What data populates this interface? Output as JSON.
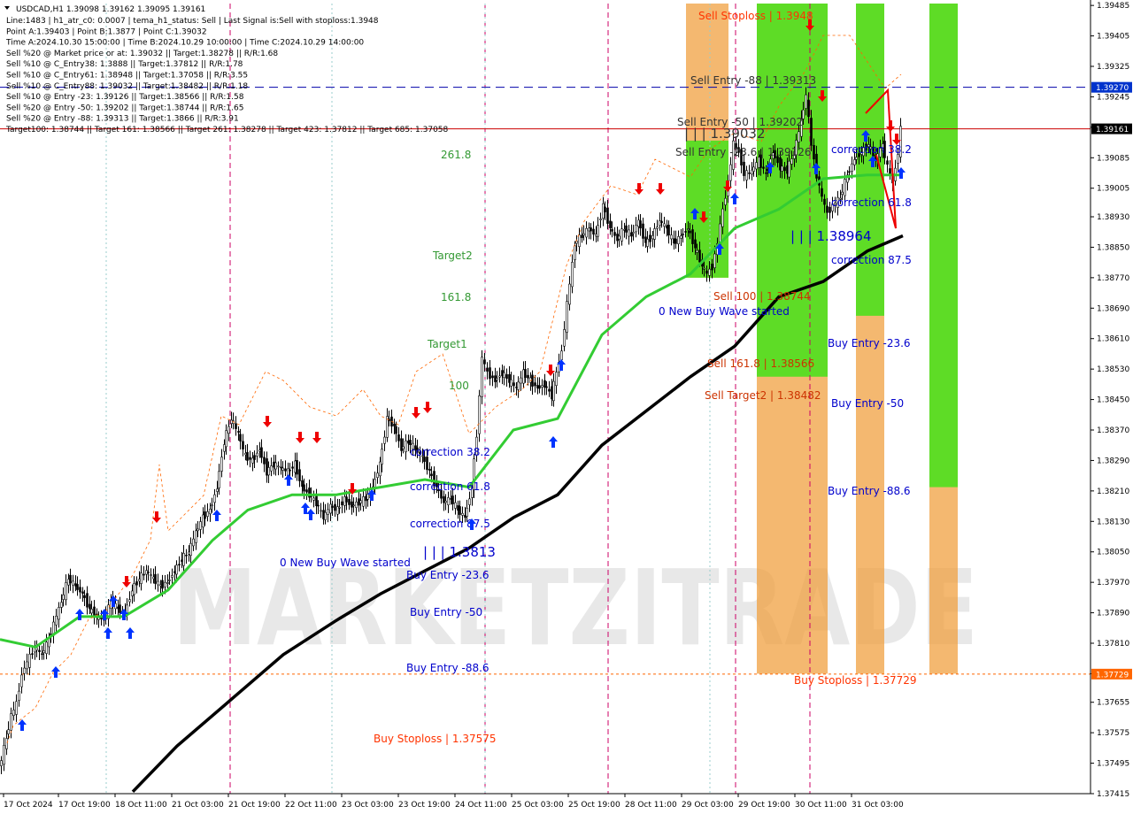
{
  "header": {
    "title": "USDCAD,H1  1.39098 1.39162 1.39095 1.39161",
    "lines": [
      "Line:1483 | h1_atr_c0: 0.0007 | tema_h1_status: Sell | Last Signal is:Sell with stoploss:1.3948",
      "Point A:1.39403 | Point B:1.3877 | Point C:1.39032",
      "Time A:2024.10.30 15:00:00 | Time B:2024.10.29 10:00:00 | Time C:2024.10.29 14:00:00",
      "Sell %20 @ Market price or at: 1.39032 || Target:1.38278 || R/R:1.68",
      "Sell %10 @ C_Entry38: 1.3888 || Target:1.37812 || R/R:1.78",
      "Sell %10 @ C_Entry61: 1.38948 || Target:1.37058 || R/R:3.55",
      "Sell %10 @ C_Entry88: 1.39032 || Target:1.38482 || R/R:1.18",
      "Sell %10 @ Entry -23: 1.39126 || Target:1.38566 || R/R:1.58",
      "Sell %20 @ Entry -50: 1.39202 || Target:1.38744 || R/R:1.65",
      "Sell %20 @ Entry -88: 1.39313 || Target:1.3866 || R/R:3.91",
      "Target100: 1.38744 || Target 161: 1.38566 || Target 261: 1.38278 || Target 423: 1.37812 || Target 685: 1.37058"
    ]
  },
  "watermark": "MARKETZITRADE",
  "labels": [
    {
      "id": "sell-stoploss",
      "text": "Sell Stoploss | 1.3948",
      "color": "#ff3300"
    },
    {
      "id": "sell-entry-88",
      "text": "Sell Entry -88 | 1.39313",
      "color": "#333333"
    },
    {
      "id": "sell-entry-50",
      "text": "Sell Entry -50 | 1.39202",
      "color": "#333333"
    },
    {
      "id": "sell-entry-23",
      "text": "Sell Entry -23.6 | 1.39126",
      "color": "#333333"
    },
    {
      "id": "price-marker-top",
      "text": "| | | 1.39032",
      "color": "#333333"
    },
    {
      "id": "price-marker-mid",
      "text": "| | | 1.38964",
      "color": "#0000cc"
    },
    {
      "id": "price-marker-low",
      "text": "| | | 1.3813",
      "color": "#0000cc"
    },
    {
      "id": "sell-100",
      "text": "Sell 100 | 1.38744",
      "color": "#cc3300"
    },
    {
      "id": "sell-161",
      "text": "Sell 161.8 | 1.38566",
      "color": "#cc3300"
    },
    {
      "id": "sell-target2",
      "text": "Sell Target2 | 1.38482",
      "color": "#cc3300"
    },
    {
      "id": "buy-stoploss-right",
      "text": "Buy Stoploss | 1.37729",
      "color": "#ff3300"
    },
    {
      "id": "buy-stoploss-left",
      "text": "Buy Stoploss | 1.37575",
      "color": "#ff3300"
    },
    {
      "id": "correction-38-r",
      "text": "correction 38.2",
      "color": "#0000cc"
    },
    {
      "id": "correction-61-r",
      "text": "correction 61.8",
      "color": "#0000cc"
    },
    {
      "id": "correction-87-r",
      "text": "correction 87.5",
      "color": "#0000cc"
    },
    {
      "id": "correction-38-l",
      "text": "correction 38.2",
      "color": "#0000cc"
    },
    {
      "id": "correction-61-l",
      "text": "correction 61.8",
      "color": "#0000cc"
    },
    {
      "id": "correction-87-l",
      "text": "correction 87.5",
      "color": "#0000cc"
    },
    {
      "id": "buy-entry-23-r",
      "text": "Buy Entry -23.6",
      "color": "#0000cc"
    },
    {
      "id": "buy-entry-50-r",
      "text": "Buy Entry -50",
      "color": "#0000cc"
    },
    {
      "id": "buy-entry-88-r",
      "text": "Buy Entry -88.6",
      "color": "#0000cc"
    },
    {
      "id": "buy-entry-23-l",
      "text": "Buy Entry -23.6",
      "color": "#0000cc"
    },
    {
      "id": "buy-entry-50-l",
      "text": "Buy Entry -50",
      "color": "#0000cc"
    },
    {
      "id": "buy-entry-88-l",
      "text": "Buy Entry -88.6",
      "color": "#0000cc"
    },
    {
      "id": "new-buy-wave-r",
      "text": "0 New Buy Wave started",
      "color": "#0000cc"
    },
    {
      "id": "new-buy-wave-l",
      "text": "0 New Buy Wave started",
      "color": "#0000cc"
    },
    {
      "id": "fib-261",
      "text": "261.8",
      "color": "#339933"
    },
    {
      "id": "fib-target2",
      "text": "Target2",
      "color": "#339933"
    },
    {
      "id": "fib-161",
      "text": "161.8",
      "color": "#339933"
    },
    {
      "id": "fib-target1",
      "text": "Target1",
      "color": "#339933"
    },
    {
      "id": "fib-100",
      "text": "100",
      "color": "#339933"
    }
  ],
  "chart_data": {
    "type": "candlestick",
    "symbol": "USDCAD",
    "timeframe": "H1",
    "ohlc_last": {
      "open": 1.39098,
      "high": 1.39162,
      "low": 1.39095,
      "close": 1.39161
    },
    "ylim": [
      1.37415,
      1.3949
    ],
    "y_ticks": [
      "1.39485",
      "1.39405",
      "1.39325",
      "1.39245",
      "1.39165",
      "1.39085",
      "1.39005",
      "1.38930",
      "1.38850",
      "1.38770",
      "1.38690",
      "1.38610",
      "1.38530",
      "1.38450",
      "1.38370",
      "1.38290",
      "1.38210",
      "1.38130",
      "1.38050",
      "1.37970",
      "1.37890",
      "1.37810",
      "1.37730",
      "1.37655",
      "1.37575",
      "1.37495",
      "1.37415"
    ],
    "x_ticks": [
      "17 Oct 2024",
      "17 Oct 19:00",
      "18 Oct 11:00",
      "21 Oct 03:00",
      "21 Oct 19:00",
      "22 Oct 11:00",
      "23 Oct 03:00",
      "23 Oct 19:00",
      "24 Oct 11:00",
      "25 Oct 03:00",
      "25 Oct 19:00",
      "28 Oct 11:00",
      "29 Oct 03:00",
      "29 Oct 19:00",
      "30 Oct 11:00",
      "31 Oct 03:00"
    ],
    "price_badges": [
      {
        "value": "1.39270",
        "color": "#0033cc"
      },
      {
        "value": "1.39161",
        "color": "#000000"
      },
      {
        "value": "1.37729",
        "color": "#ff6600"
      }
    ],
    "horizontal_lines": [
      {
        "name": "sell-entry-88",
        "value": 1.3927,
        "color": "#0000aa",
        "style": "dashed"
      },
      {
        "name": "current",
        "value": 1.39161,
        "color": "#cc0000",
        "style": "solid"
      },
      {
        "name": "buy-stoploss",
        "value": 1.37729,
        "color": "#ff6600",
        "style": "dotted"
      }
    ],
    "close_path": [
      [
        0,
        1.3748
      ],
      [
        8,
        1.3756
      ],
      [
        14,
        1.3762
      ],
      [
        20,
        1.3765
      ],
      [
        26,
        1.3773
      ],
      [
        32,
        1.3776
      ],
      [
        40,
        1.378
      ],
      [
        48,
        1.3778
      ],
      [
        56,
        1.3782
      ],
      [
        62,
        1.3786
      ],
      [
        70,
        1.3792
      ],
      [
        78,
        1.3798
      ],
      [
        86,
        1.3796
      ],
      [
        94,
        1.3794
      ],
      [
        102,
        1.379
      ],
      [
        110,
        1.3788
      ],
      [
        118,
        1.3787
      ],
      [
        126,
        1.3792
      ],
      [
        134,
        1.379
      ],
      [
        142,
        1.3789
      ],
      [
        150,
        1.3795
      ],
      [
        158,
        1.3798
      ],
      [
        166,
        1.38
      ],
      [
        174,
        1.3798
      ],
      [
        182,
        1.3796
      ],
      [
        190,
        1.3797
      ],
      [
        198,
        1.38
      ],
      [
        206,
        1.3803
      ],
      [
        214,
        1.3805
      ],
      [
        222,
        1.381
      ],
      [
        230,
        1.3814
      ],
      [
        238,
        1.3816
      ],
      [
        246,
        1.3822
      ],
      [
        254,
        1.3834
      ],
      [
        262,
        1.384
      ],
      [
        270,
        1.3836
      ],
      [
        278,
        1.383
      ],
      [
        286,
        1.3829
      ],
      [
        294,
        1.3832
      ],
      [
        302,
        1.3826
      ],
      [
        310,
        1.3828
      ],
      [
        318,
        1.3827
      ],
      [
        326,
        1.3826
      ],
      [
        334,
        1.3828
      ],
      [
        342,
        1.3822
      ],
      [
        350,
        1.382
      ],
      [
        358,
        1.3818
      ],
      [
        366,
        1.3814
      ],
      [
        374,
        1.3817
      ],
      [
        382,
        1.3816
      ],
      [
        390,
        1.3819
      ],
      [
        398,
        1.3817
      ],
      [
        406,
        1.3818
      ],
      [
        414,
        1.3819
      ],
      [
        422,
        1.3822
      ],
      [
        430,
        1.3828
      ],
      [
        438,
        1.384
      ],
      [
        446,
        1.3838
      ],
      [
        454,
        1.3832
      ],
      [
        462,
        1.3834
      ],
      [
        470,
        1.3832
      ],
      [
        478,
        1.383
      ],
      [
        486,
        1.3826
      ],
      [
        494,
        1.3822
      ],
      [
        502,
        1.3818
      ],
      [
        510,
        1.3819
      ],
      [
        518,
        1.3816
      ],
      [
        526,
        1.3814
      ],
      [
        534,
        1.3822
      ],
      [
        540,
        1.3836
      ],
      [
        546,
        1.3856
      ],
      [
        552,
        1.3852
      ],
      [
        560,
        1.385
      ],
      [
        568,
        1.3852
      ],
      [
        576,
        1.385
      ],
      [
        584,
        1.3848
      ],
      [
        592,
        1.3852
      ],
      [
        600,
        1.385
      ],
      [
        608,
        1.3848
      ],
      [
        616,
        1.3849
      ],
      [
        624,
        1.3846
      ],
      [
        630,
        1.3852
      ],
      [
        636,
        1.3858
      ],
      [
        642,
        1.387
      ],
      [
        650,
        1.3886
      ],
      [
        658,
        1.3888
      ],
      [
        666,
        1.389
      ],
      [
        674,
        1.3888
      ],
      [
        682,
        1.3896
      ],
      [
        690,
        1.389
      ],
      [
        698,
        1.3887
      ],
      [
        706,
        1.389
      ],
      [
        714,
        1.3888
      ],
      [
        722,
        1.3892
      ],
      [
        730,
        1.3886
      ],
      [
        738,
        1.3888
      ],
      [
        746,
        1.3892
      ],
      [
        754,
        1.389
      ],
      [
        762,
        1.3886
      ],
      [
        770,
        1.3888
      ],
      [
        778,
        1.389
      ],
      [
        786,
        1.3885
      ],
      [
        794,
        1.388
      ],
      [
        800,
        1.3878
      ],
      [
        806,
        1.388
      ],
      [
        812,
        1.3886
      ],
      [
        818,
        1.3895
      ],
      [
        824,
        1.3902
      ],
      [
        830,
        1.3912
      ],
      [
        836,
        1.391
      ],
      [
        842,
        1.3904
      ],
      [
        850,
        1.3905
      ],
      [
        858,
        1.3908
      ],
      [
        866,
        1.3904
      ],
      [
        874,
        1.391
      ],
      [
        882,
        1.3906
      ],
      [
        890,
        1.3905
      ],
      [
        898,
        1.391
      ],
      [
        906,
        1.3918
      ],
      [
        912,
        1.3925
      ],
      [
        918,
        1.3912
      ],
      [
        924,
        1.3904
      ],
      [
        930,
        1.3898
      ],
      [
        936,
        1.3894
      ],
      [
        942,
        1.3896
      ],
      [
        950,
        1.3898
      ],
      [
        958,
        1.3904
      ],
      [
        966,
        1.3908
      ],
      [
        974,
        1.391
      ],
      [
        982,
        1.3912
      ],
      [
        990,
        1.3908
      ],
      [
        998,
        1.3912
      ],
      [
        1004,
        1.3906
      ],
      [
        1010,
        1.3902
      ],
      [
        1016,
        1.391
      ],
      [
        1020,
        1.3916
      ]
    ],
    "ma_fast": [
      [
        0,
        1.3782
      ],
      [
        40,
        1.378
      ],
      [
        90,
        1.3788
      ],
      [
        140,
        1.3788
      ],
      [
        190,
        1.3795
      ],
      [
        240,
        1.3808
      ],
      [
        280,
        1.3816
      ],
      [
        330,
        1.382
      ],
      [
        380,
        1.382
      ],
      [
        430,
        1.3822
      ],
      [
        480,
        1.3824
      ],
      [
        530,
        1.3822
      ],
      [
        580,
        1.3837
      ],
      [
        630,
        1.384
      ],
      [
        680,
        1.3862
      ],
      [
        730,
        1.3872
      ],
      [
        780,
        1.3878
      ],
      [
        830,
        1.389
      ],
      [
        880,
        1.3895
      ],
      [
        930,
        1.3903
      ],
      [
        980,
        1.3904
      ],
      [
        1020,
        1.3904
      ]
    ],
    "ma_slow": [
      [
        150,
        1.3742
      ],
      [
        200,
        1.3754
      ],
      [
        260,
        1.3766
      ],
      [
        320,
        1.3778
      ],
      [
        380,
        1.3787
      ],
      [
        430,
        1.3794
      ],
      [
        480,
        1.38
      ],
      [
        530,
        1.3806
      ],
      [
        580,
        1.3814
      ],
      [
        630,
        1.382
      ],
      [
        680,
        1.3833
      ],
      [
        730,
        1.3842
      ],
      [
        780,
        1.3851
      ],
      [
        830,
        1.3859
      ],
      [
        880,
        1.3872
      ],
      [
        930,
        1.3876
      ],
      [
        980,
        1.3884
      ],
      [
        1020,
        1.3888
      ]
    ],
    "zones": [
      {
        "color": "#f0a040",
        "price_top": 1.3949,
        "price_bottom": 1.3877,
        "x0": 775,
        "x1": 823
      },
      {
        "color": "#55dd22",
        "price_top": 1.3913,
        "price_bottom": 1.3877,
        "x0": 775,
        "x1": 823
      },
      {
        "color": "#f0a040",
        "price_top": 1.3949,
        "price_bottom": 1.3773,
        "x0": 855,
        "x1": 935
      },
      {
        "color": "#55dd22",
        "price_top": 1.3949,
        "price_bottom": 1.3851,
        "x0": 855,
        "x1": 935
      },
      {
        "color": "#f0a040",
        "price_top": 1.3949,
        "price_bottom": 1.3773,
        "x0": 967,
        "x1": 999
      },
      {
        "color": "#55dd22",
        "price_top": 1.3949,
        "price_bottom": 1.3867,
        "x0": 967,
        "x1": 999
      },
      {
        "color": "#f0a040",
        "price_top": 1.3949,
        "price_bottom": 1.3773,
        "x0": 1050,
        "x1": 1082
      },
      {
        "color": "#55dd22",
        "price_top": 1.3949,
        "price_bottom": 1.3822,
        "x0": 1050,
        "x1": 1082
      }
    ]
  }
}
